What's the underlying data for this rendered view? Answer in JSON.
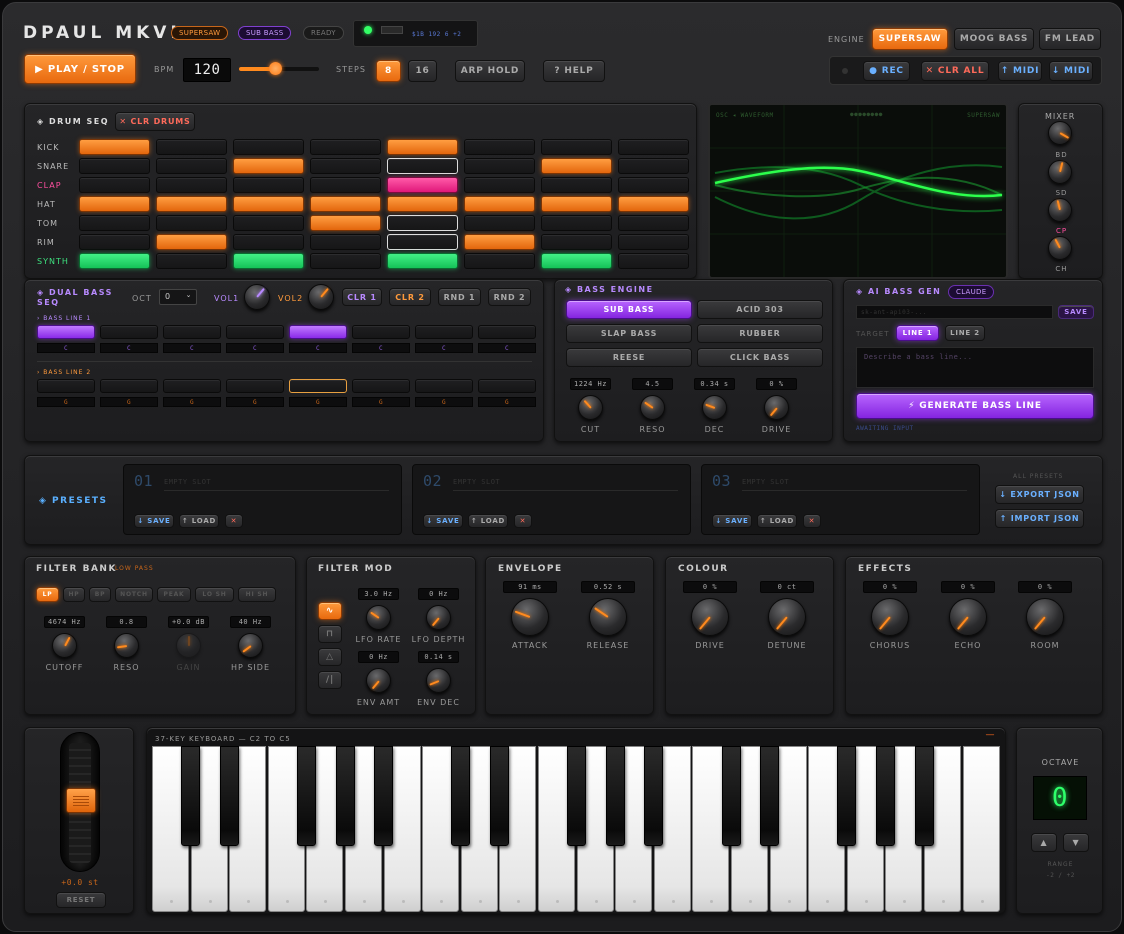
{
  "header": {
    "title": "DPAUL MKVI",
    "badge_supersaw": "SUPERSAW",
    "badge_subbass": "SUB BASS",
    "badge_ready": "READY",
    "midi_info": "$1B 192 6 +2",
    "play_label": "▶ PLAY / STOP",
    "bpm_label": "BPM",
    "bpm_value": "120",
    "bpm_fraction": 0.45,
    "steps_label": "STEPS",
    "steps_options": [
      "8",
      "16"
    ],
    "arp_hold_label": "ARP HOLD",
    "help_label": "? HELP",
    "engine_label": "ENGINE",
    "engines": [
      "SUPERSAW",
      "MOOG BASS",
      "FM LEAD"
    ],
    "rec_label": "● REC",
    "clr_all_label": "✕ CLR ALL",
    "midi_out_label": "↑ MIDI",
    "midi_in_label": "↓ MIDI"
  },
  "drums": {
    "title": "◈ DRUM SEQ",
    "clear_label": "✕ CLR DRUMS",
    "rows": [
      {
        "name": "KICK",
        "color": "#bbbbbb",
        "on": "#ff8a1e",
        "steps": [
          1,
          0,
          0,
          0,
          1,
          0,
          0,
          0
        ]
      },
      {
        "name": "SNARE",
        "color": "#bbbbbb",
        "on": "#ff8a1e",
        "steps": [
          0,
          0,
          1,
          0,
          0,
          0,
          1,
          0
        ]
      },
      {
        "name": "CLAP",
        "color": "#ff4fa0",
        "on": "#ff3e96",
        "steps": [
          0,
          0,
          0,
          0,
          1,
          0,
          0,
          0
        ]
      },
      {
        "name": "HAT",
        "color": "#bbbbbb",
        "on": "#ff8a1e",
        "steps": [
          1,
          1,
          1,
          1,
          1,
          1,
          1,
          1
        ]
      },
      {
        "name": "TOM",
        "color": "#bbbbbb",
        "on": "#ff8a1e",
        "steps": [
          0,
          0,
          0,
          1,
          0,
          0,
          0,
          0
        ]
      },
      {
        "name": "RIM",
        "color": "#bbbbbb",
        "on": "#ff8a1e",
        "steps": [
          0,
          1,
          0,
          0,
          0,
          1,
          0,
          0
        ]
      },
      {
        "name": "SYNTH",
        "color": "#3ee07e",
        "on": "#2ee07a",
        "steps": [
          1,
          0,
          1,
          0,
          1,
          0,
          1,
          0
        ]
      }
    ],
    "current_step": 4
  },
  "scope": {
    "title": "OSC ◂ WAVEFORM",
    "dots": "●●●●●●●●",
    "engine": "SUPERSAW"
  },
  "mixer": {
    "title": "MIXER",
    "channels": [
      {
        "label": "BD",
        "value": 0.55
      },
      {
        "label": "SD",
        "value": 0.45
      },
      {
        "label": "CP",
        "value": 0.4
      },
      {
        "label": "CH",
        "value": 0.5
      }
    ]
  },
  "dual_bass": {
    "title": "◈ DUAL BASS SEQ",
    "oct_label": "OCT",
    "oct_value": "0",
    "vol1_label": "VOL1",
    "vol2_label": "VOL2",
    "buttons": [
      "CLR 1",
      "CLR 2",
      "RND 1",
      "RND 2"
    ],
    "line1_label": "› BASS LINE 1",
    "line1_notes": [
      "C",
      "C",
      "C",
      "C",
      "C",
      "C",
      "C",
      "C"
    ],
    "line1_steps": [
      1,
      0,
      0,
      0,
      1,
      0,
      0,
      0
    ],
    "line2_label": "› BASS LINE 2",
    "line2_notes": [
      "G",
      "G",
      "G",
      "G",
      "G",
      "G",
      "G",
      "G"
    ],
    "line2_steps": [
      0,
      0,
      0,
      0,
      0,
      0,
      0,
      0
    ],
    "line2_current": 4
  },
  "bass_engine": {
    "title": "◈ BASS ENGINE",
    "modes": [
      "SUB BASS",
      "ACID 303",
      "SLAP BASS",
      "RUBBER",
      "REESE",
      "CLICK BASS"
    ],
    "active_mode": 0,
    "knobs": [
      {
        "label": "CUT",
        "readout": "1224 Hz",
        "value": 0.35
      },
      {
        "label": "RESO",
        "readout": "4.5",
        "value": 0.3
      },
      {
        "label": "DEC",
        "readout": "0.34 s",
        "value": 0.25
      },
      {
        "label": "DRIVE",
        "readout": "0 %",
        "value": 0.0
      }
    ]
  },
  "ai_bass": {
    "title": "◈ AI BASS GEN",
    "badge": "CLAUDE",
    "key_placeholder": "sk-ant-api03-...",
    "save_label": "SAVE",
    "target_label": "TARGET",
    "targets": [
      "LINE 1",
      "LINE 2"
    ],
    "prompt_placeholder": "Describe a bass line...",
    "generate_label": "⚡ GENERATE BASS LINE",
    "status": "AWAITING INPUT"
  },
  "presets": {
    "title": "◈ PRESETS",
    "slots": [
      {
        "num": "01",
        "name": "EMPTY SLOT"
      },
      {
        "num": "02",
        "name": "EMPTY SLOT"
      },
      {
        "num": "03",
        "name": "EMPTY SLOT"
      }
    ],
    "save_label": "↓ SAVE",
    "load_label": "↑ LOAD",
    "delete_label": "✕",
    "all_label": "ALL PRESETS",
    "export_label": "↓ EXPORT JSON",
    "import_label": "↑ IMPORT JSON"
  },
  "filter_bank": {
    "title": "FILTER BANK",
    "mode": "LOW PASS",
    "types": [
      "LP",
      "HP",
      "BP",
      "NOTCH",
      "PEAK",
      "LO SH",
      "HI SH"
    ],
    "active_type": 0,
    "knobs": [
      {
        "label": "CUTOFF",
        "readout": "4674 Hz",
        "value": 0.6
      },
      {
        "label": "RESO",
        "readout": "0.8",
        "value": 0.15
      },
      {
        "label": "GAIN",
        "readout": "+0.0 dB",
        "value": 0.5,
        "disabled": true
      },
      {
        "label": "HP SIDE",
        "readout": "40 Hz",
        "value": 0.05
      }
    ]
  },
  "filter_mod": {
    "title": "FILTER MOD",
    "shapes": [
      "∿",
      "⊓",
      "△",
      "/|"
    ],
    "active_shape": 0,
    "knobs": [
      {
        "label": "LFO RATE",
        "readout": "3.0 Hz",
        "value": 0.3
      },
      {
        "label": "LFO DEPTH",
        "readout": "0 Hz",
        "value": 0.0
      },
      {
        "label": "ENV AMT",
        "readout": "0 Hz",
        "value": 0.0
      },
      {
        "label": "ENV DEC",
        "readout": "0.14 s",
        "value": 0.1
      }
    ]
  },
  "envelope": {
    "title": "ENVELOPE",
    "knobs": [
      {
        "label": "ATTACK",
        "readout": "91 ms",
        "value": 0.25
      },
      {
        "label": "RELEASE",
        "readout": "0.52 s",
        "value": 0.3
      }
    ]
  },
  "colour": {
    "title": "COLOUR",
    "knobs": [
      {
        "label": "DRIVE",
        "readout": "0 %",
        "value": 0.0
      },
      {
        "label": "DETUNE",
        "readout": "0 ct",
        "value": 0.0
      }
    ]
  },
  "effects": {
    "title": "EFFECTS",
    "knobs": [
      {
        "label": "CHORUS",
        "readout": "0 %",
        "value": 0.0
      },
      {
        "label": "ECHO",
        "readout": "0 %",
        "value": 0.0
      },
      {
        "label": "ROOM",
        "readout": "0 %",
        "value": 0.0
      }
    ]
  },
  "pitch": {
    "value": "+0.0 st",
    "reset_label": "RESET",
    "level": 0.5
  },
  "keyboard": {
    "title": "37-KEY KEYBOARD — C2 TO C5",
    "indicator": "—"
  },
  "octave": {
    "title": "OCTAVE",
    "value": "0",
    "up": "▲",
    "down": "▼",
    "range_label": "RANGE",
    "range_value": "-2 / +2"
  },
  "colors": {
    "accent": "#ff8a1e",
    "purple": "#9a3cf0",
    "green": "#2ee07a",
    "pink": "#ff3e96",
    "blue": "#5aa8ff"
  }
}
